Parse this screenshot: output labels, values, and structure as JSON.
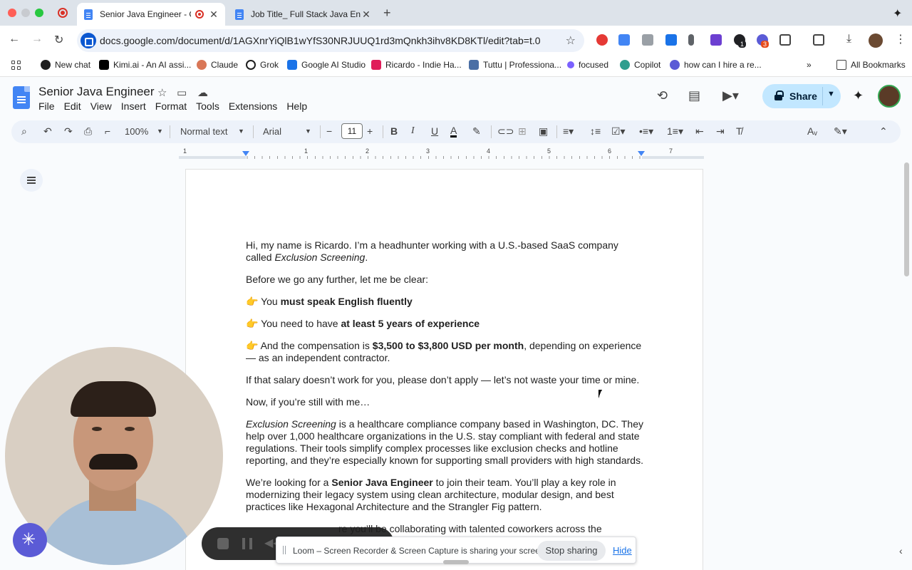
{
  "browser": {
    "tabs": [
      {
        "title": "Senior Java Engineer - Go",
        "active": true
      },
      {
        "title": "Job Title_ Full Stack Java Eng",
        "active": false
      }
    ],
    "url": "docs.google.com/document/d/1AGXnrYiQlB1wYfS30NRJUUQ1rd3mQnkh3ihv8KD8KTl/edit?tab=t.0",
    "extension_badges": [
      "1",
      "3"
    ],
    "bookmarks": [
      {
        "label": "New chat",
        "color": "#1f1f1f"
      },
      {
        "label": "Kimi.ai - An AI assi...",
        "color": "#000000"
      },
      {
        "label": "Claude",
        "color": "#d97757"
      },
      {
        "label": "Grok",
        "color": "#1f1f1f"
      },
      {
        "label": "Google AI Studio",
        "color": "#1a73e8"
      },
      {
        "label": "Ricardo - Indie Ha...",
        "color": "#e01e5a"
      },
      {
        "label": "Tuttu | Professiona...",
        "color": "#4a6fa5"
      },
      {
        "label": "focused",
        "color": "#7b61ff"
      },
      {
        "label": "Copilot",
        "color": "#2f9e8f"
      },
      {
        "label": "how can I hire a re...",
        "color": "#5b5bd6"
      }
    ],
    "all_bookmarks_label": "All Bookmarks"
  },
  "docs": {
    "title": "Senior Java Engineer",
    "menu": [
      "File",
      "Edit",
      "View",
      "Insert",
      "Format",
      "Tools",
      "Extensions",
      "Help"
    ],
    "share_label": "Share",
    "toolbar": {
      "zoom": "100%",
      "style": "Normal text",
      "font": "Arial",
      "font_size": "11"
    },
    "ruler_numbers": [
      "1",
      "1",
      "2",
      "3",
      "4",
      "5",
      "6",
      "7"
    ]
  },
  "document": {
    "p1_a": "Hi, my name is Ricardo. I’m a headhunter working with a U.S.-based SaaS company called ",
    "p1_b": "Exclusion Screening",
    "p1_c": ".",
    "p2": "Before we go any further, let me be clear:",
    "pointer": "👉",
    "b1_a": "You ",
    "b1_b": "must speak English fluently",
    "b2_a": "You need to have ",
    "b2_b": "at least 5 years of experience",
    "b3_a": "And the compensation is ",
    "b3_b": "$3,500 to $3,800 USD per month",
    "b3_c": ", depending on experience — as an independent contractor.",
    "p3": "If that salary doesn’t work for you, please don’t apply — let’s not waste your time or mine.",
    "p4": "Now, if you’re still with me…",
    "p5_a": "Exclusion Screening",
    "p5_b": " is a healthcare compliance company based in Washington, DC. They help over 1,000 healthcare organizations in the U.S. stay compliant with federal and state regulations. Their tools simplify complex processes like exclusion checks and hotline reporting, and they’re especially known for supporting small providers with high standards.",
    "p6_a": "We’re looking for a ",
    "p6_b": "Senior Java Engineer",
    "p6_c": " to join their team. You’ll play a key role in modernizing their legacy system using clean architecture, modular design, and best practices like Hexagonal Architecture and the Strangler Fig pattern.",
    "p7_partial": "re you’ll be collaborating with talented coworkers across the"
  },
  "loom_bar": {
    "message": "Loom – Screen Recorder & Screen Capture is sharing your screen.",
    "stop_label": "Stop sharing",
    "hide_label": "Hide"
  }
}
